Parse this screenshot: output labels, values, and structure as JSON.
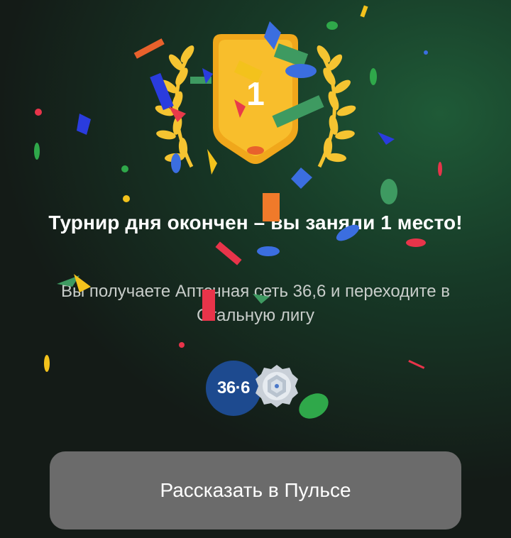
{
  "result": {
    "title": "Турнир дня окончен – вы заняли 1 место!",
    "message": "Вы получаете Аптечная сеть 36,6 и переходите в Стальную лигу",
    "place_number": "1"
  },
  "rewards": {
    "pharmacy_logo_text": "36·6",
    "league_badge_icon": "steel-league-badge-icon"
  },
  "actions": {
    "share_label": "Рассказать в Пульсе"
  },
  "icons": {
    "trophy": "trophy-shield-icon",
    "laurel_left": "laurel-left-icon",
    "laurel_right": "laurel-right-icon",
    "confetti": "confetti-icon"
  },
  "colors": {
    "background": "#141917",
    "background_glow": "#1f5a37",
    "trophy_gold": "#f7b21b",
    "button": "#6b6b6b",
    "pharmacy_blue": "#1d4a8f"
  }
}
